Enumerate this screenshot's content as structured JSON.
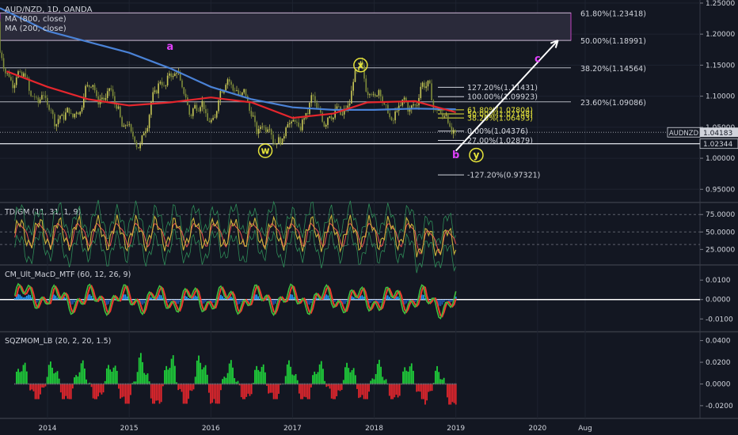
{
  "chart_data": {
    "type": "candlestick",
    "symbol_title": "AUD/NZD, 1D, OANDA",
    "overlays": [
      "MA (800, close)",
      "MA (200, close)"
    ],
    "x_ticks": [
      "2014",
      "2015",
      "2016",
      "2017",
      "2018",
      "2019",
      "2020",
      "Aug"
    ],
    "y_ticks": [
      "1.25000",
      "1.20000",
      "1.15000",
      "1.10000",
      "1.05000",
      "1.00000",
      "0.95000"
    ],
    "ylim": [
      0.93,
      1.255
    ],
    "price": {
      "points": [
        [
          "2013-01",
          1.22
        ],
        [
          "2013-04",
          1.18
        ],
        [
          "2013-07",
          1.14
        ],
        [
          "2013-10",
          1.12
        ],
        [
          "2014-01",
          1.08
        ],
        [
          "2014-04",
          1.06
        ],
        [
          "2014-07",
          1.11
        ],
        [
          "2014-10",
          1.1
        ],
        [
          "2015-01",
          1.05
        ],
        [
          "2015-02",
          1.005
        ],
        [
          "2015-04",
          1.08
        ],
        [
          "2015-07",
          1.145
        ],
        [
          "2015-10",
          1.085
        ],
        [
          "2016-01",
          1.065
        ],
        [
          "2016-04",
          1.13
        ],
        [
          "2016-07",
          1.07
        ],
        [
          "2016-10",
          1.03
        ],
        [
          "2017-01",
          1.05
        ],
        [
          "2017-04",
          1.085
        ],
        [
          "2017-07",
          1.06
        ],
        [
          "2017-09",
          1.09
        ],
        [
          "2017-11",
          1.145
        ],
        [
          "2018-01",
          1.1
        ],
        [
          "2018-04",
          1.07
        ],
        [
          "2018-07",
          1.095
        ],
        [
          "2018-09",
          1.115
        ],
        [
          "2018-10",
          1.09
        ],
        [
          "2018-12",
          1.045
        ],
        [
          "2019-01",
          1.04183
        ]
      ]
    },
    "ma800_points": [
      [
        "2013-01",
        1.242
      ],
      [
        "2014-01",
        1.205
      ],
      [
        "2015-01",
        1.17
      ],
      [
        "2015-07",
        1.145
      ],
      [
        "2016-01",
        1.115
      ],
      [
        "2016-07",
        1.095
      ],
      [
        "2017-01",
        1.082
      ],
      [
        "2017-07",
        1.078
      ],
      [
        "2018-01",
        1.078
      ],
      [
        "2018-07",
        1.08
      ],
      [
        "2019-01",
        1.079
      ]
    ],
    "ma200_points": [
      [
        "2013-07",
        1.14
      ],
      [
        "2014-01",
        1.115
      ],
      [
        "2014-07",
        1.095
      ],
      [
        "2015-01",
        1.085
      ],
      [
        "2015-07",
        1.09
      ],
      [
        "2016-01",
        1.098
      ],
      [
        "2016-07",
        1.09
      ],
      [
        "2017-01",
        1.065
      ],
      [
        "2017-07",
        1.072
      ],
      [
        "2017-12",
        1.09
      ],
      [
        "2018-07",
        1.092
      ],
      [
        "2019-01",
        1.074
      ]
    ],
    "zone": {
      "from": 1.18991,
      "to": 1.23418
    },
    "fib_lines": [
      {
        "label": "61.80%(1.23418)",
        "value": 1.23418
      },
      {
        "label": "50.00%(1.18991)",
        "value": 1.18991
      },
      {
        "label": "38.20%(1.14564)",
        "value": 1.14564
      },
      {
        "label": "23.60%(1.09086)",
        "value": 1.09086
      }
    ],
    "fib_ext": [
      {
        "label": "127.20%(1.11431)",
        "value": 1.11431,
        "color": "#d1d4dc"
      },
      {
        "label": "100.00%(1.09923)",
        "value": 1.09923,
        "color": "#d1d4dc"
      },
      {
        "label": "61.80%(1.07804)",
        "value": 1.07804,
        "color": "#e5e33a"
      },
      {
        "label": "50.00%(1.07148)",
        "value": 1.07148,
        "color": "#e5e33a"
      },
      {
        "label": "38.20%(1.06493)",
        "value": 1.06493,
        "color": "#e5e33a"
      },
      {
        "label": "0.00%(1.04376)",
        "value": 1.04376,
        "color": "#d1d4dc"
      },
      {
        "label": "27.00%(1.02879)",
        "value": 1.02879,
        "color": "#d1d4dc"
      },
      {
        "label": "-127.20%(0.97321)",
        "value": 0.97321,
        "color": "#d1d4dc"
      }
    ],
    "hlines": [
      1.02344
    ],
    "last_price": {
      "symbol": "AUDNZD",
      "value": "1.04183"
    },
    "support_tag": "1.02344",
    "waves": [
      {
        "label": "a",
        "date": "2015-07",
        "value": 1.175,
        "color": "#e040fb",
        "circle": false
      },
      {
        "label": "x",
        "date": "2017-11",
        "value": 1.145,
        "color": "#f5f5f5",
        "circle": true
      },
      {
        "label": "w",
        "date": "2016-09",
        "value": 1.007,
        "color": "#f5f5f5",
        "circle": true
      },
      {
        "label": "b",
        "date": "2019-01",
        "value": 1.0,
        "color": "#e040fb",
        "circle": false
      },
      {
        "label": "y",
        "date": "2019-04",
        "value": 1.0,
        "color": "#f5f5f5",
        "circle": true
      },
      {
        "label": "c",
        "date": "2020-01",
        "value": 1.155,
        "color": "#e040fb",
        "circle": false
      }
    ],
    "arrow": {
      "from": [
        "2019-01",
        1.012
      ],
      "to": [
        "2020-04",
        1.19
      ]
    },
    "panels": [
      {
        "title": "TDIGM (11, 31, 1, 9)",
        "ticks": [
          "75.0000",
          "50.0000",
          "25.0000"
        ],
        "ylim": [
          5,
          90
        ]
      },
      {
        "title": "CM_Ult_MacD_MTF (60, 12, 26, 9)",
        "ticks": [
          "0.0100",
          "0.0000",
          "-0.0100"
        ],
        "ylim": [
          -0.016,
          0.017
        ]
      },
      {
        "title": "SQZMOM_LB (20, 2, 20, 1.5)",
        "ticks": [
          "0.0400",
          "0.0200",
          "0.0000",
          "-0.0200"
        ],
        "ylim": [
          -0.031,
          0.047
        ]
      }
    ],
    "colors": {
      "background": "#131722",
      "up": "#26a69a",
      "down": "#ef5350",
      "candle_up": "#c8c856",
      "candle_down": "#7e8c3a",
      "ma800": "#4a82d6",
      "ma200": "#e5262d",
      "zone_fill": "#2a2a3a",
      "zone_border": "#c040c0",
      "text": "#d1d4dc",
      "grid": "#1e2330",
      "arrow": "#ffffff"
    }
  }
}
